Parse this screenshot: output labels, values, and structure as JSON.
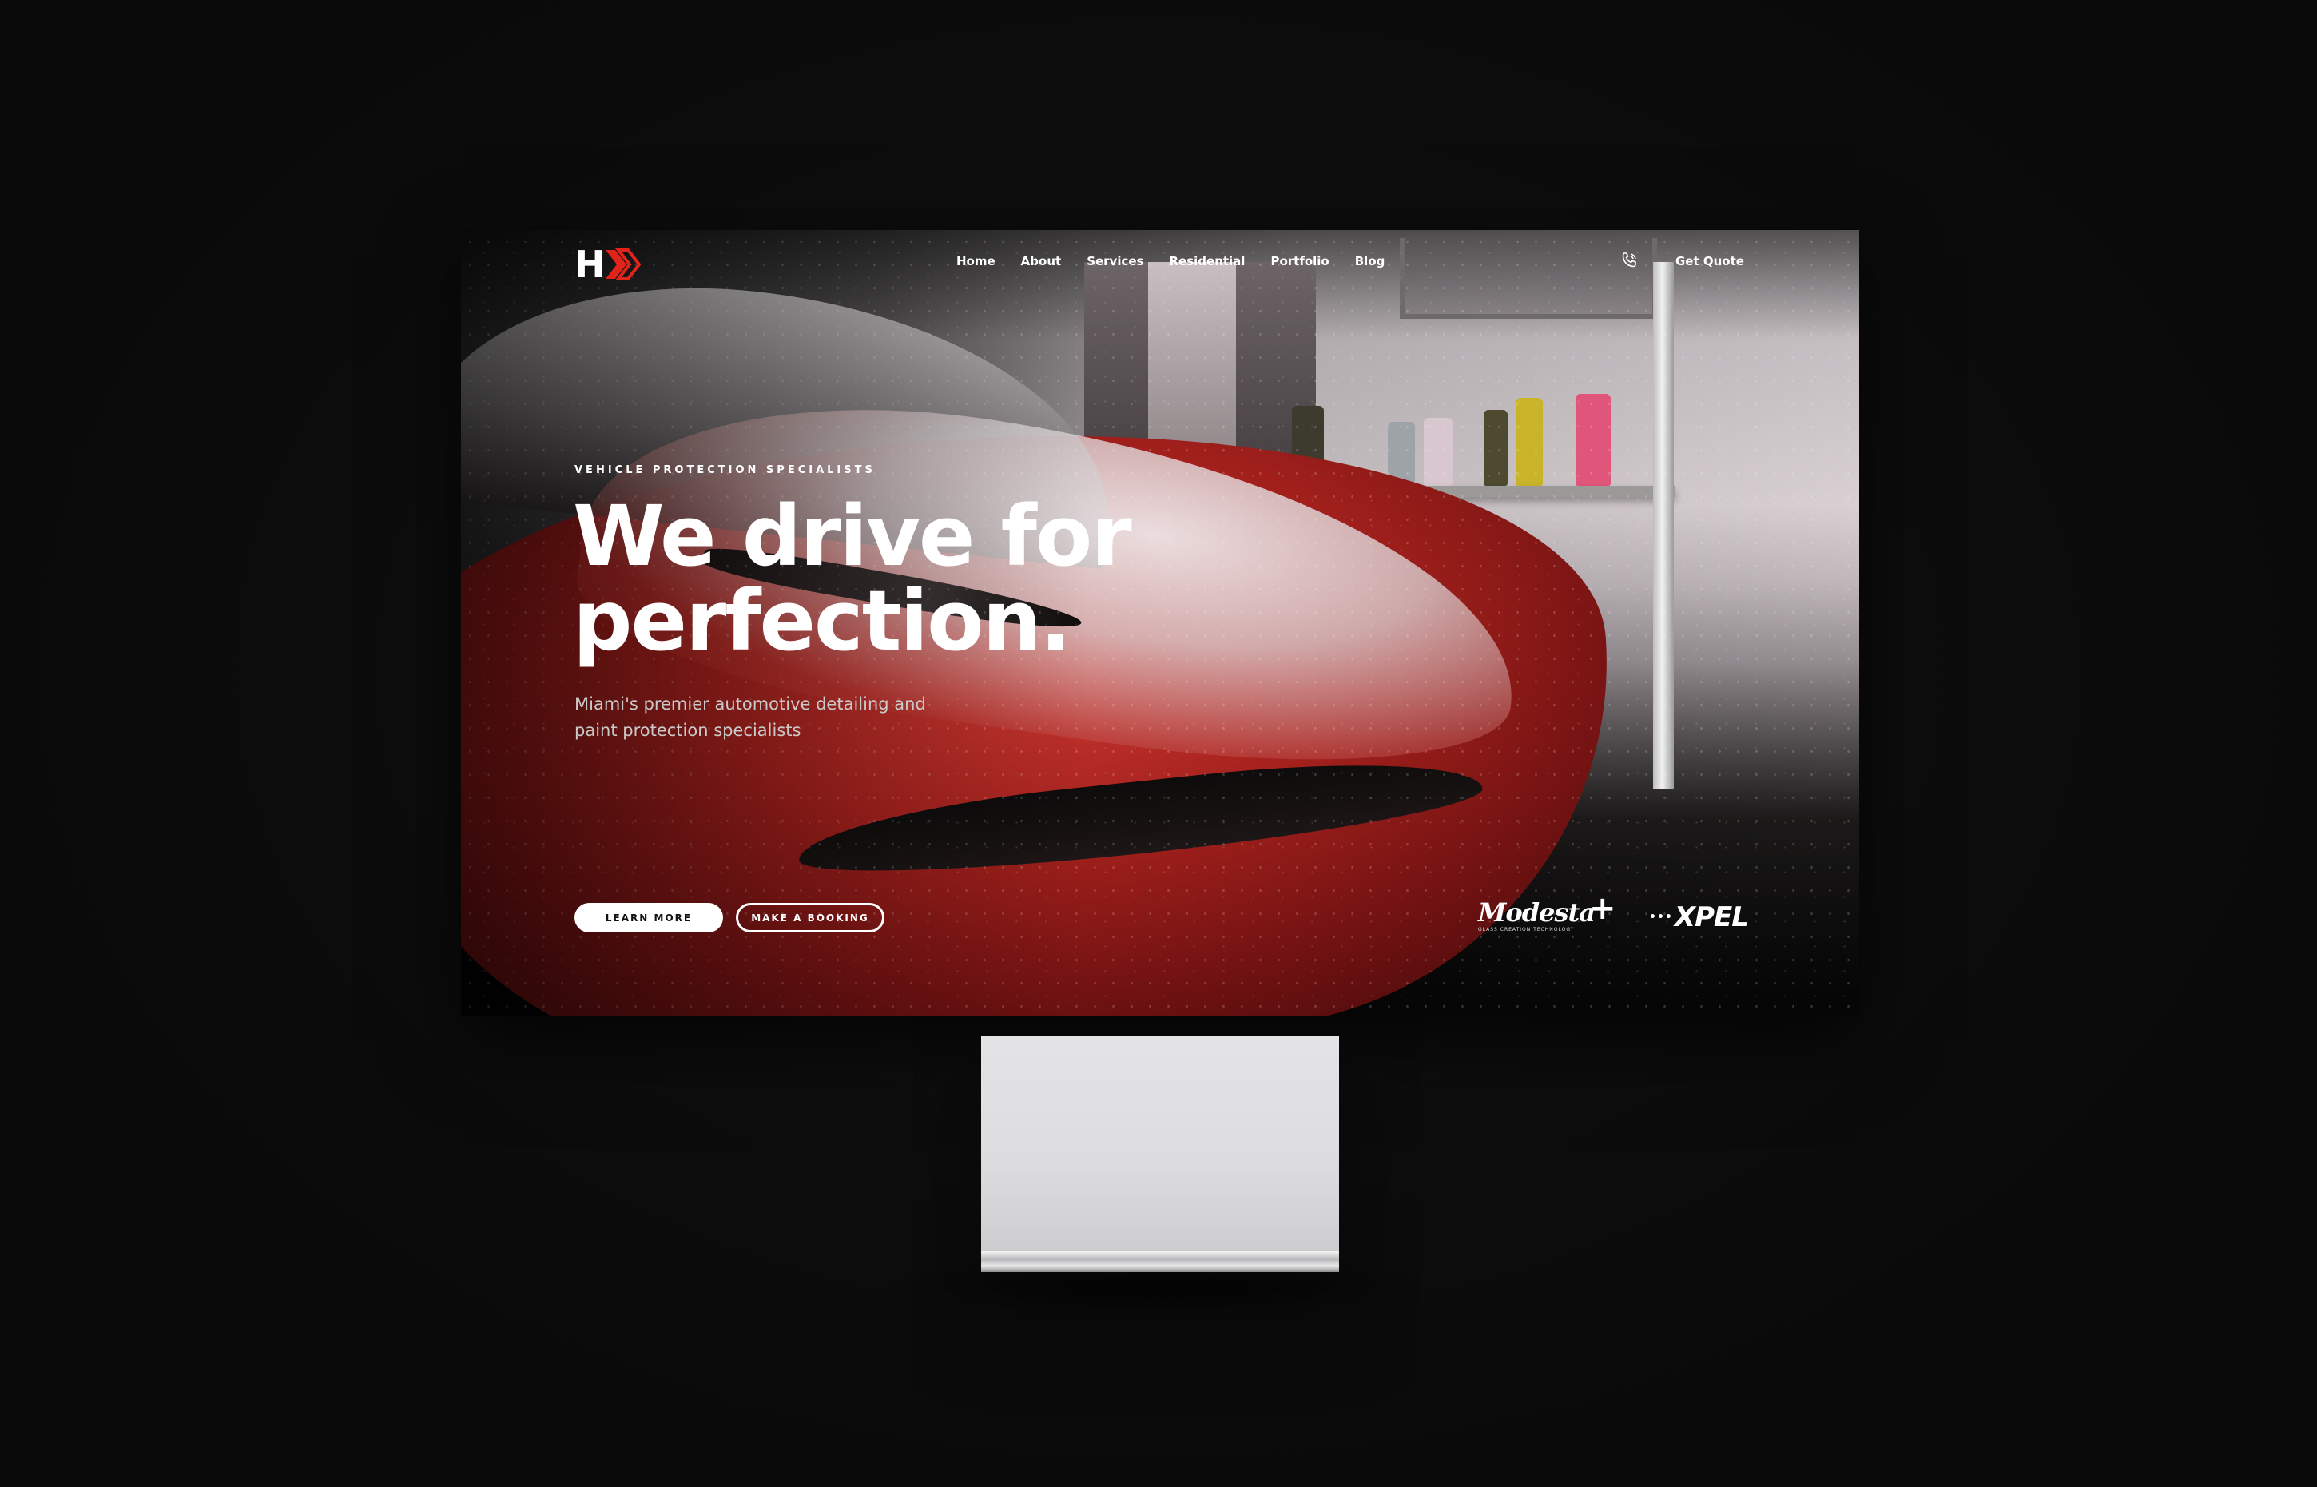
{
  "nav": {
    "logo_text": "H",
    "links": [
      "Home",
      "About",
      "Services",
      "Residential",
      "Portfolio",
      "Blog"
    ],
    "phone_icon": "phone-icon",
    "cta_label": "Get Quote"
  },
  "hero": {
    "eyebrow": "VEHICLE PROTECTION SPECIALISTS",
    "headline_line1": "We drive for",
    "headline_line2": "perfection.",
    "subtitle": "Miami's premier automotive detailing and paint protection specialists",
    "primary_button": "LEARN MORE",
    "secondary_button": "MAKE A BOOKING"
  },
  "partners": {
    "modesta": "Modesta",
    "modesta_tagline": "GLASS CREATION TECHNOLOGY",
    "plus": "+",
    "xpel": "XPEL"
  },
  "colors": {
    "brand_red": "#e2231a",
    "background": "#0c0c0c",
    "text_primary": "#ffffff",
    "text_secondary": "#c9c9c9"
  }
}
